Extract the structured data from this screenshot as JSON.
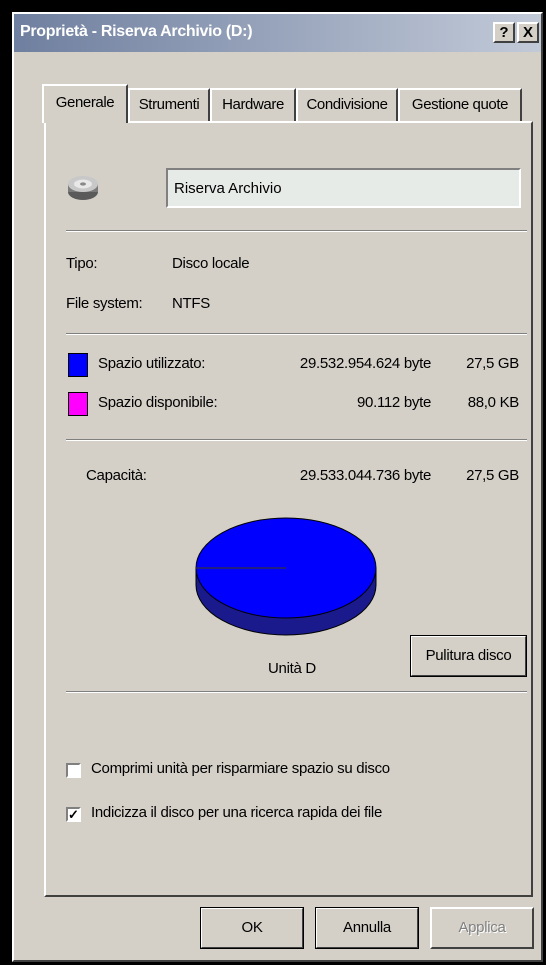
{
  "window": {
    "title": "Proprietà - Riserva Archivio (D:)",
    "help_glyph": "?",
    "close_glyph": "X"
  },
  "tabs": [
    {
      "label": "Generale",
      "active": true
    },
    {
      "label": "Strumenti"
    },
    {
      "label": "Hardware"
    },
    {
      "label": "Condivisione"
    },
    {
      "label": "Gestione quote"
    }
  ],
  "general": {
    "drive_icon": "hard-drive-icon",
    "volume_name": "Riserva Archivio",
    "type_label": "Tipo:",
    "type_value": "Disco locale",
    "fs_label": "File system:",
    "fs_value": "NTFS",
    "used": {
      "label": "Spazio utilizzato:",
      "bytes": "29.532.954.624 byte",
      "size": "27,5 GB",
      "color": "#0000ff"
    },
    "free": {
      "label": "Spazio disponibile:",
      "bytes": "90.112 byte",
      "size": "88,0 KB",
      "color": "#ff00ff"
    },
    "capacity": {
      "label": "Capacità:",
      "bytes": "29.533.044.736 byte",
      "size": "27,5 GB"
    },
    "used_fraction": 0.999997,
    "drive_label": "Unità D",
    "cleanup_button": "Pulitura disco",
    "compress": {
      "label": "Comprimi unità per risparmiare spazio su disco",
      "checked": false
    },
    "index": {
      "label": "Indicizza il disco per una ricerca rapida dei file",
      "checked": true
    }
  },
  "buttons": {
    "ok": "OK",
    "cancel": "Annulla",
    "apply": "Applica"
  }
}
